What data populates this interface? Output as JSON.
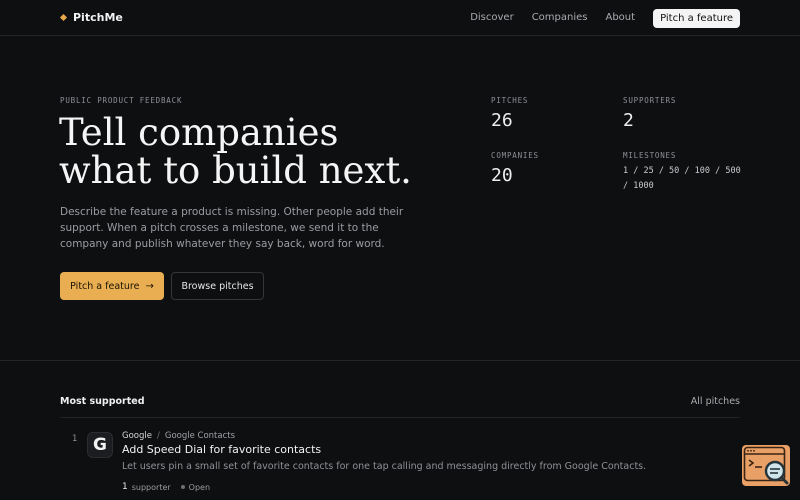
{
  "header": {
    "brand": "PitchMe",
    "nav": [
      "Discover",
      "Companies",
      "About"
    ],
    "cta": "Pitch a feature"
  },
  "hero": {
    "eyebrow": "PUBLIC PRODUCT FEEDBACK",
    "headline_line1": "Tell companies",
    "headline_line2": "what to build next.",
    "subtext": "Describe the feature a product is missing. Other people add their support. When a pitch crosses a milestone, we send it to the company and publish whatever they say back, word for word.",
    "primary_button": "Pitch a feature",
    "secondary_button": "Browse pitches"
  },
  "stats": {
    "pitches": {
      "label": "PITCHES",
      "value": "26"
    },
    "supporters": {
      "label": "SUPPORTERS",
      "value": "2"
    },
    "companies": {
      "label": "COMPANIES",
      "value": "20"
    },
    "milestones": {
      "label": "MILESTONES",
      "value": "1 / 25 / 50 / 100 / 500 / 1000"
    }
  },
  "most_supported": {
    "title": "Most supported",
    "all_link": "All pitches",
    "items": [
      {
        "rank": "1",
        "avatar_letter": "G",
        "company": "Google",
        "separator": "/",
        "product": "Google Contacts",
        "title": "Add Speed Dial for favorite contacts",
        "description": "Let users pin a small set of favorite contacts for one tap calling and messaging directly from Google Contacts.",
        "supporters": "1",
        "supporters_label": "supporter",
        "status": "Open"
      }
    ]
  },
  "colors": {
    "accent": "#e9ae52",
    "background": "#0e0f11",
    "widget": "#e9a066"
  }
}
